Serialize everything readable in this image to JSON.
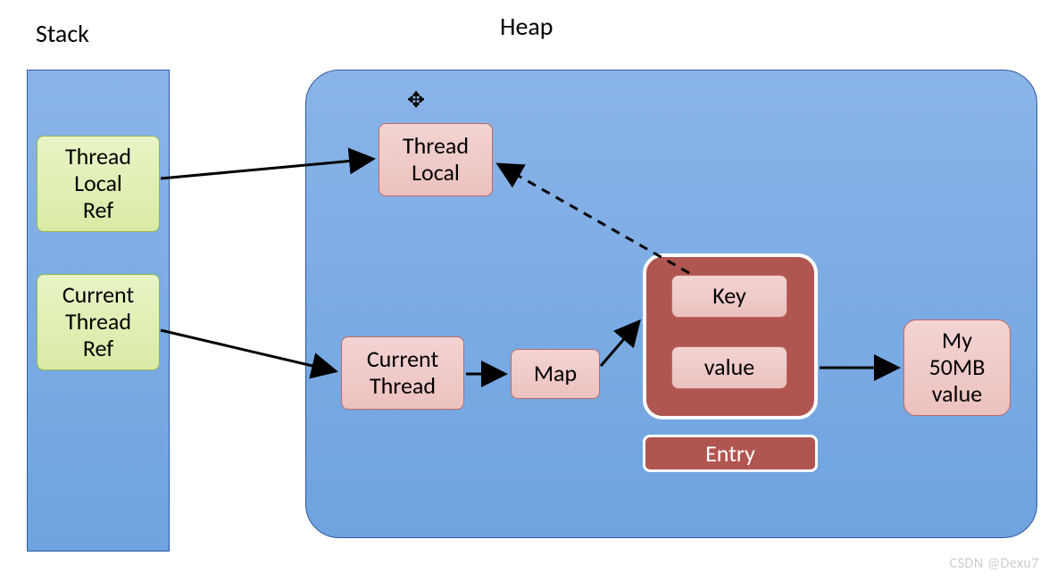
{
  "titles": {
    "stack": "Stack",
    "heap": "Heap"
  },
  "stack": {
    "thread_local_ref": "Thread\nLocal\nRef",
    "current_thread_ref": "Current\nThread\nRef"
  },
  "heap": {
    "thread_local": "Thread\nLocal",
    "current_thread": "Current\nThread",
    "map": "Map",
    "entry": {
      "label": "Entry",
      "key": "Key",
      "value": "value"
    },
    "my_value": "My\n50MB\nvalue"
  },
  "watermark": "CSDN @Dexu7",
  "diagram_meta": {
    "type": "memory-model",
    "description": "Java ThreadLocal memory layout showing Stack references into Heap objects",
    "arrows": [
      {
        "from": "thread-local-ref",
        "to": "thread-local-heap",
        "style": "solid"
      },
      {
        "from": "current-thread-ref",
        "to": "current-thread-heap",
        "style": "solid"
      },
      {
        "from": "current-thread-heap",
        "to": "map",
        "style": "solid"
      },
      {
        "from": "map",
        "to": "entry-container",
        "style": "solid"
      },
      {
        "from": "key",
        "to": "thread-local-heap",
        "style": "dashed"
      },
      {
        "from": "value",
        "to": "my-value",
        "style": "solid"
      }
    ]
  }
}
